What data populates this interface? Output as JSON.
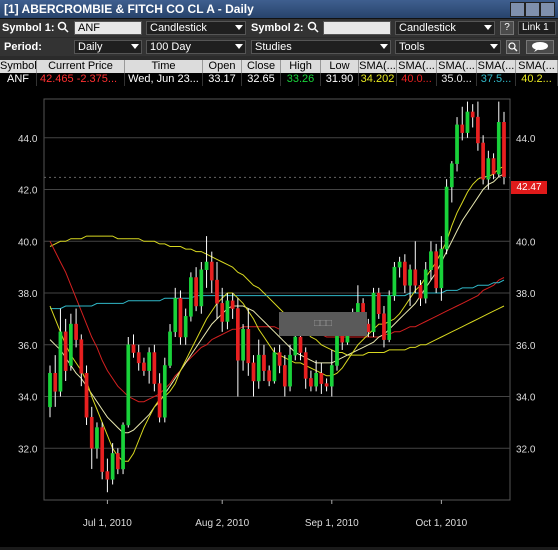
{
  "window": {
    "title": "[1] ABERCROMBIE & FITCH CO CL A - Daily"
  },
  "toolbar1": {
    "symbol1_label": "Symbol 1:",
    "symbol1_value": "ANF",
    "chart_type1": "Candlestick",
    "symbol2_label": "Symbol 2:",
    "symbol2_value": "",
    "chart_type2": "Candlestick",
    "help": "?",
    "link": "Link 1"
  },
  "toolbar2": {
    "period_label": "Period:",
    "period_value": "Daily",
    "range_value": "100 Day",
    "studies_value": "Studies",
    "tools_value": "Tools"
  },
  "table": {
    "headers": [
      "Symbol",
      "Current Price",
      "Time",
      "Open",
      "Close",
      "High",
      "Low",
      "SMA(...",
      "SMA(...",
      "SMA(...",
      "SMA(...",
      "SMA(..."
    ],
    "row": {
      "symbol": "ANF",
      "current_price": "42.465",
      "change": "-2.375...",
      "time": "Wed, Jun 23...",
      "open": "33.17",
      "close": "32.65",
      "high": "33.26",
      "low": "31.90",
      "sma1": "34.202",
      "sma2": "40.0...",
      "sma3": "35.0...",
      "sma4": "37.5...",
      "sma5": "40.2..."
    }
  },
  "colors": {
    "up": "#19d23a",
    "down": "#e82020",
    "sma_yellow": "#d8d820",
    "sma_red": "#d42020",
    "sma_cyan": "#30b8c8",
    "sma_white": "#e8e8b0"
  },
  "price_tag": "42.47",
  "crosshair_label": "□□□",
  "chart_data": {
    "type": "candlestick",
    "ylim": [
      30.0,
      45.5
    ],
    "y_ticks": [
      "32.0",
      "34.0",
      "36.0",
      "38.0",
      "40.0",
      "42.0",
      "44.0"
    ],
    "x_ticks": [
      "Jul 1, 2010",
      "Aug 2, 2010",
      "Sep 1, 2010",
      "Oct 1, 2010"
    ],
    "x_tick_index": [
      11,
      33,
      54,
      75
    ],
    "candles": [
      [
        33.6,
        34.9,
        33.2,
        35.2
      ],
      [
        34.9,
        34.2,
        33.6,
        35.6
      ],
      [
        34.2,
        36.5,
        34.0,
        37.4
      ],
      [
        36.5,
        35.0,
        34.6,
        37.0
      ],
      [
        35.2,
        36.8,
        35.0,
        37.2
      ],
      [
        36.8,
        36.2,
        35.9,
        37.4
      ],
      [
        36.2,
        34.9,
        34.4,
        36.4
      ],
      [
        34.9,
        33.2,
        32.9,
        35.2
      ],
      [
        33.2,
        32.0,
        31.2,
        33.6
      ],
      [
        32.0,
        32.8,
        31.6,
        33.0
      ],
      [
        32.8,
        31.1,
        30.8,
        33.0
      ],
      [
        31.1,
        30.8,
        30.3,
        31.6
      ],
      [
        30.8,
        31.8,
        30.6,
        32.2
      ],
      [
        31.8,
        31.2,
        31.0,
        32.0
      ],
      [
        31.2,
        32.9,
        31.0,
        33.0
      ],
      [
        32.9,
        36.0,
        32.8,
        36.3
      ],
      [
        36.0,
        35.7,
        35.5,
        36.4
      ],
      [
        35.7,
        35.3,
        35.0,
        36.0
      ],
      [
        35.3,
        35.0,
        34.8,
        35.5
      ],
      [
        35.0,
        35.7,
        34.5,
        35.9
      ],
      [
        35.7,
        34.5,
        34.2,
        36.0
      ],
      [
        34.5,
        33.2,
        33.0,
        34.9
      ],
      [
        33.2,
        35.2,
        33.0,
        35.5
      ],
      [
        35.2,
        36.5,
        35.1,
        36.8
      ],
      [
        36.5,
        37.8,
        36.3,
        38.2
      ],
      [
        37.8,
        36.3,
        36.0,
        38.1
      ],
      [
        36.3,
        37.1,
        36.0,
        37.4
      ],
      [
        37.1,
        38.6,
        36.9,
        38.8
      ],
      [
        38.6,
        37.5,
        37.3,
        39.0
      ],
      [
        37.5,
        38.9,
        37.2,
        39.2
      ],
      [
        38.9,
        39.2,
        38.2,
        40.2
      ],
      [
        39.2,
        38.5,
        38.0,
        39.6
      ],
      [
        38.5,
        37.6,
        37.0,
        39.2
      ],
      [
        37.6,
        36.9,
        36.5,
        38.2
      ],
      [
        36.9,
        37.7,
        36.6,
        38.0
      ],
      [
        37.7,
        37.4,
        37.0,
        38.0
      ],
      [
        37.4,
        35.4,
        34.0,
        37.8
      ],
      [
        35.4,
        36.6,
        35.0,
        36.8
      ],
      [
        36.6,
        35.3,
        34.8,
        37.4
      ],
      [
        35.3,
        34.6,
        34.0,
        35.6
      ],
      [
        34.6,
        35.6,
        34.3,
        36.2
      ],
      [
        35.6,
        35.0,
        34.6,
        36.0
      ],
      [
        35.0,
        34.6,
        34.4,
        35.2
      ],
      [
        34.6,
        35.7,
        34.5,
        35.9
      ],
      [
        35.7,
        35.2,
        34.9,
        36.0
      ],
      [
        35.2,
        34.4,
        34.0,
        35.6
      ],
      [
        34.4,
        35.6,
        34.2,
        36.0
      ],
      [
        35.6,
        36.3,
        35.4,
        36.6
      ],
      [
        36.3,
        35.7,
        35.4,
        36.6
      ],
      [
        35.7,
        34.7,
        34.3,
        35.9
      ],
      [
        34.7,
        34.4,
        34.2,
        35.0
      ],
      [
        34.4,
        34.9,
        34.2,
        35.4
      ],
      [
        34.9,
        34.5,
        34.1,
        35.3
      ],
      [
        34.5,
        34.4,
        34.2,
        34.7
      ],
      [
        34.4,
        35.2,
        34.0,
        35.8
      ],
      [
        35.2,
        36.8,
        35.0,
        37.0
      ],
      [
        36.8,
        36.1,
        35.8,
        37.2
      ],
      [
        36.1,
        36.8,
        36.0,
        37.0
      ],
      [
        36.8,
        36.9,
        36.6,
        37.4
      ],
      [
        36.9,
        37.6,
        36.7,
        38.3
      ],
      [
        37.6,
        36.8,
        36.6,
        37.8
      ],
      [
        36.8,
        36.5,
        36.3,
        37.0
      ],
      [
        36.5,
        38.0,
        36.3,
        38.2
      ],
      [
        38.0,
        37.2,
        37.0,
        38.2
      ],
      [
        37.2,
        36.2,
        35.9,
        37.5
      ],
      [
        36.2,
        37.9,
        36.1,
        38.1
      ],
      [
        37.9,
        39.0,
        37.7,
        39.2
      ],
      [
        39.0,
        39.2,
        38.6,
        39.4
      ],
      [
        39.2,
        38.3,
        38.0,
        39.5
      ],
      [
        38.3,
        38.9,
        37.5,
        39.1
      ],
      [
        38.9,
        38.3,
        38.0,
        40.0
      ],
      [
        38.3,
        37.8,
        37.5,
        38.5
      ],
      [
        37.8,
        38.9,
        37.6,
        39.2
      ],
      [
        38.9,
        39.6,
        38.5,
        40.0
      ],
      [
        39.6,
        38.2,
        38.0,
        39.9
      ],
      [
        38.2,
        39.7,
        37.7,
        40.2
      ],
      [
        39.7,
        42.1,
        39.5,
        42.4
      ],
      [
        42.1,
        43.0,
        41.5,
        43.1
      ],
      [
        43.0,
        44.5,
        42.7,
        44.8
      ],
      [
        44.5,
        44.2,
        43.9,
        45.2
      ],
      [
        44.2,
        45.0,
        44.0,
        45.4
      ],
      [
        45.0,
        44.8,
        44.4,
        45.3
      ],
      [
        44.8,
        43.8,
        43.5,
        45.4
      ],
      [
        43.8,
        42.4,
        42.2,
        44.1
      ],
      [
        42.4,
        43.2,
        42.0,
        43.5
      ],
      [
        43.2,
        42.6,
        42.4,
        43.4
      ],
      [
        42.6,
        44.6,
        42.5,
        45.4
      ],
      [
        44.6,
        42.5,
        42.2,
        45.0
      ]
    ],
    "sma_yellow_long": [
      39.8,
      39.9,
      40.0,
      40.0,
      40.1,
      40.1,
      40.1,
      40.2,
      40.2,
      40.2,
      40.2,
      40.2,
      40.2,
      40.1,
      40.1,
      40.1,
      40.1,
      40.1,
      40.0,
      40.0,
      40.0,
      39.9,
      39.9,
      39.8,
      39.8,
      39.8,
      39.7,
      39.7,
      39.6,
      39.6,
      39.5,
      39.4,
      39.3,
      39.2,
      39.1,
      39.0,
      38.8,
      38.7,
      38.5,
      38.3,
      38.2,
      38.0,
      37.8,
      37.6,
      37.4,
      37.2,
      37.0,
      36.8,
      36.7,
      36.5,
      36.3,
      36.2,
      36.0,
      35.9,
      35.8,
      35.7,
      35.7,
      35.6,
      35.6,
      35.6,
      35.6,
      35.7,
      35.7,
      35.7,
      35.7,
      35.8,
      35.8,
      35.8,
      35.8,
      35.9,
      35.9,
      36.0,
      36.0,
      36.1,
      36.2,
      36.3,
      36.4,
      36.5,
      36.6,
      36.7,
      36.8,
      36.9,
      37.0,
      37.1,
      37.2,
      37.3,
      37.4,
      37.5
    ],
    "sma_red": [
      40.0,
      39.6,
      39.2,
      38.8,
      38.3,
      37.8,
      37.3,
      36.8,
      36.3,
      35.9,
      35.4,
      35.0,
      34.7,
      34.4,
      34.2,
      34.0,
      33.9,
      33.8,
      33.8,
      33.9,
      34.0,
      34.1,
      34.3,
      34.5,
      34.8,
      35.0,
      35.3,
      35.5,
      35.7,
      35.9,
      36.0,
      36.2,
      36.3,
      36.4,
      36.5,
      36.6,
      36.6,
      36.7,
      36.7,
      36.7,
      36.7,
      36.7,
      36.7,
      36.7,
      36.6,
      36.6,
      36.6,
      36.6,
      36.5,
      36.5,
      36.5,
      36.4,
      36.4,
      36.3,
      36.3,
      36.3,
      36.3,
      36.3,
      36.3,
      36.3,
      36.3,
      36.3,
      36.3,
      36.3,
      36.4,
      36.4,
      36.5,
      36.5,
      36.6,
      36.7,
      36.7,
      36.8,
      36.9,
      37.0,
      37.1,
      37.2,
      37.3,
      37.4,
      37.5,
      37.6,
      37.7,
      37.8,
      37.9,
      38.1,
      38.2,
      38.3,
      38.5,
      38.6
    ],
    "sma_cyan": [
      37.4,
      37.4,
      37.4,
      37.5,
      37.5,
      37.5,
      37.5,
      37.5,
      37.5,
      37.6,
      37.6,
      37.6,
      37.6,
      37.6,
      37.6,
      37.7,
      37.7,
      37.7,
      37.7,
      37.7,
      37.7,
      37.7,
      37.8,
      37.8,
      37.8,
      37.8,
      37.8,
      37.8,
      37.9,
      37.9,
      37.9,
      37.9,
      37.9,
      37.9,
      37.9,
      37.9,
      37.9,
      37.9,
      37.9,
      37.9,
      37.9,
      37.9,
      37.9,
      37.9,
      37.9,
      37.9,
      37.9,
      37.9,
      37.9,
      37.9,
      37.9,
      37.9,
      37.9,
      37.9,
      37.9,
      37.9,
      37.9,
      37.9,
      37.9,
      37.9,
      37.9,
      37.9,
      37.9,
      37.9,
      37.9,
      37.9,
      37.9,
      37.9,
      37.9,
      38.0,
      38.0,
      38.0,
      38.0,
      38.0,
      38.0,
      38.0,
      38.1,
      38.1,
      38.1,
      38.2,
      38.2,
      38.2,
      38.3,
      38.3,
      38.3,
      38.4,
      38.4,
      38.5
    ],
    "sma_short": [
      37.5,
      37.0,
      36.5,
      36.0,
      35.6,
      35.3,
      35.0,
      34.6,
      34.0,
      33.5,
      33.0,
      32.5,
      32.0,
      31.7,
      31.5,
      31.5,
      31.8,
      32.3,
      32.8,
      33.2,
      33.6,
      33.9,
      34.0,
      34.2,
      34.5,
      35.0,
      35.4,
      35.8,
      36.2,
      36.6,
      37.0,
      37.3,
      37.6,
      37.8,
      38.0,
      38.0,
      37.8,
      37.6,
      37.3,
      37.0,
      36.6,
      36.3,
      36.0,
      35.7,
      35.6,
      35.5,
      35.4,
      35.3,
      35.3,
      35.2,
      35.1,
      35.0,
      34.9,
      34.8,
      34.8,
      34.9,
      35.1,
      35.4,
      35.7,
      36.0,
      36.2,
      36.4,
      36.6,
      36.8,
      36.8,
      36.9,
      37.0,
      37.2,
      37.5,
      37.8,
      38.1,
      38.3,
      38.6,
      38.9,
      39.2,
      39.6,
      40.0,
      40.6,
      41.1,
      41.5,
      41.9,
      42.2,
      42.4,
      42.5,
      42.5,
      42.6,
      42.8,
      42.9
    ],
    "sma_mid": [
      36.2,
      36.0,
      35.8,
      35.5,
      35.2,
      34.9,
      34.7,
      34.4,
      34.1,
      33.8,
      33.5,
      33.2,
      33.0,
      32.8,
      32.6,
      32.6,
      32.7,
      32.9,
      33.1,
      33.3,
      33.6,
      33.8,
      34.1,
      34.4,
      34.7,
      35.0,
      35.3,
      35.6,
      35.9,
      36.2,
      36.5,
      36.8,
      37.0,
      37.2,
      37.4,
      37.5,
      37.5,
      37.5,
      37.4,
      37.3,
      37.1,
      36.9,
      36.7,
      36.5,
      36.3,
      36.1,
      35.9,
      35.7,
      35.6,
      35.5,
      35.4,
      35.3,
      35.3,
      35.3,
      35.3,
      35.4,
      35.5,
      35.6,
      35.7,
      35.8,
      35.9,
      36.0,
      36.1,
      36.3,
      36.4,
      36.6,
      36.8,
      37.0,
      37.2,
      37.4,
      37.6,
      37.9,
      38.2,
      38.5,
      38.8,
      39.2,
      39.6,
      40.0,
      40.4,
      40.8,
      41.1,
      41.4,
      41.7,
      42.0,
      42.2,
      42.3,
      42.5,
      42.6
    ]
  }
}
